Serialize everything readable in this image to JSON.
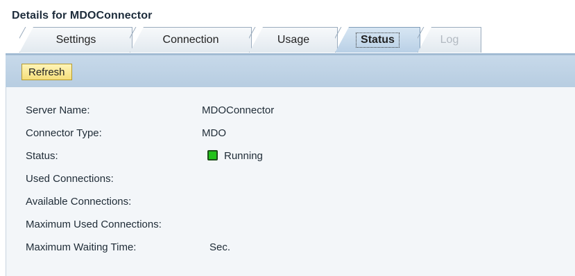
{
  "header": {
    "title": "Details for MDOConnector"
  },
  "tabs": [
    {
      "label": "Settings",
      "state": "normal"
    },
    {
      "label": "Connection",
      "state": "normal"
    },
    {
      "label": "Usage",
      "state": "normal"
    },
    {
      "label": "Status",
      "state": "active"
    },
    {
      "label": "Log",
      "state": "disabled"
    }
  ],
  "toolbar": {
    "refresh_label": "Refresh"
  },
  "details": {
    "server_name": {
      "label": "Server Name:",
      "value": "MDOConnector"
    },
    "connector_type": {
      "label": "Connector Type:",
      "value": "MDO"
    },
    "status": {
      "label": "Status:",
      "value": "Running",
      "indicator_color": "#22c21a"
    },
    "used_connections": {
      "label": "Used Connections:",
      "value": ""
    },
    "available_connections": {
      "label": "Available Connections:",
      "value": ""
    },
    "max_used_connections": {
      "label": "Maximum Used Connections:",
      "value": ""
    },
    "max_waiting_time": {
      "label": "Maximum Waiting Time:",
      "value": "Sec."
    }
  }
}
